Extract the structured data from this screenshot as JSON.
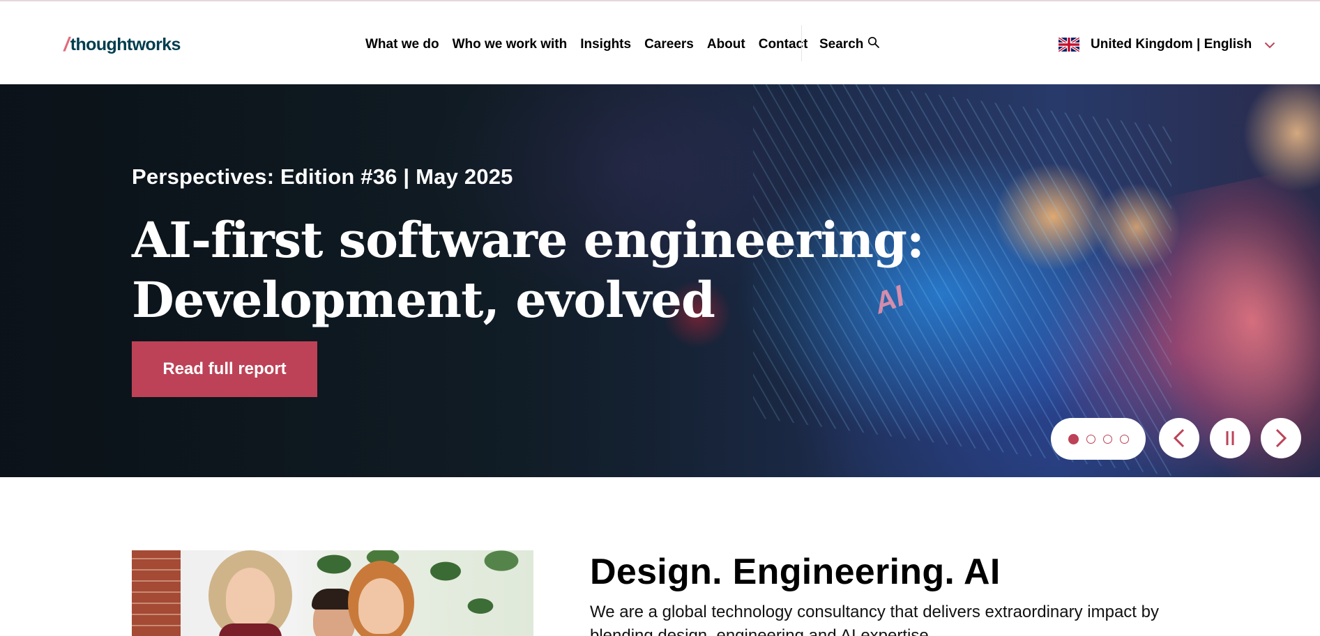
{
  "header": {
    "logo": {
      "slash": "/",
      "wordmark": "thoughtworks"
    },
    "nav": [
      {
        "label": "What we do"
      },
      {
        "label": "Who we work with"
      },
      {
        "label": "Insights"
      },
      {
        "label": "Careers"
      },
      {
        "label": "About"
      },
      {
        "label": "Contact"
      }
    ],
    "search_label": "Search",
    "locale": {
      "flag": "uk-flag-icon",
      "label": "United Kingdom | English"
    }
  },
  "hero": {
    "edition": "Perspectives: Edition #36 | May 2025",
    "title_line1": "AI-first software engineering:",
    "title_line2": "Development, evolved",
    "image_text": "AI",
    "cta_label": "Read full report",
    "carousel": {
      "slides": 4,
      "active": 1
    },
    "icons": {
      "prev": "chevron-left-icon",
      "pause": "pause-icon",
      "next": "chevron-right-icon"
    }
  },
  "intro": {
    "title": "Design. Engineering. AI",
    "body": "We are a global technology consultancy that delivers extraordinary impact by blending design, engineering and AI expertise."
  },
  "colors": {
    "brand_red": "#bd4257",
    "logo_slash": "#e16a7c",
    "logo_text": "#003d4f"
  }
}
